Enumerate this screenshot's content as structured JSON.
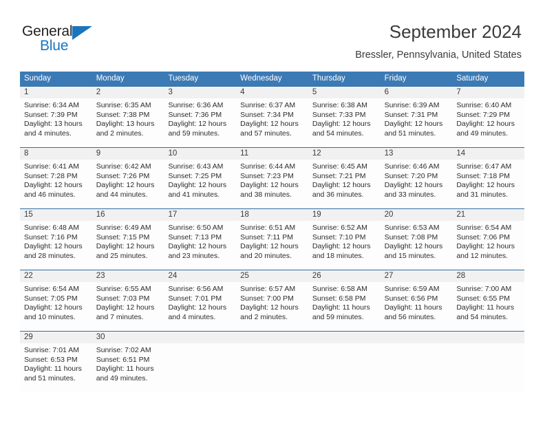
{
  "brand": {
    "name_part1": "General",
    "name_part2": "Blue",
    "accent_color": "#1b75bc"
  },
  "header": {
    "title": "September 2024",
    "subtitle": "Bressler, Pennsylvania, United States"
  },
  "theme": {
    "header_blue": "#3c7ab5",
    "grid_line": "#2e6da4",
    "date_band": "#f1f1f1"
  },
  "weekdays": [
    "Sunday",
    "Monday",
    "Tuesday",
    "Wednesday",
    "Thursday",
    "Friday",
    "Saturday"
  ],
  "weeks": [
    [
      {
        "day": "1",
        "sunrise": "Sunrise: 6:34 AM",
        "sunset": "Sunset: 7:39 PM",
        "daylight1": "Daylight: 13 hours",
        "daylight2": "and 4 minutes."
      },
      {
        "day": "2",
        "sunrise": "Sunrise: 6:35 AM",
        "sunset": "Sunset: 7:38 PM",
        "daylight1": "Daylight: 13 hours",
        "daylight2": "and 2 minutes."
      },
      {
        "day": "3",
        "sunrise": "Sunrise: 6:36 AM",
        "sunset": "Sunset: 7:36 PM",
        "daylight1": "Daylight: 12 hours",
        "daylight2": "and 59 minutes."
      },
      {
        "day": "4",
        "sunrise": "Sunrise: 6:37 AM",
        "sunset": "Sunset: 7:34 PM",
        "daylight1": "Daylight: 12 hours",
        "daylight2": "and 57 minutes."
      },
      {
        "day": "5",
        "sunrise": "Sunrise: 6:38 AM",
        "sunset": "Sunset: 7:33 PM",
        "daylight1": "Daylight: 12 hours",
        "daylight2": "and 54 minutes."
      },
      {
        "day": "6",
        "sunrise": "Sunrise: 6:39 AM",
        "sunset": "Sunset: 7:31 PM",
        "daylight1": "Daylight: 12 hours",
        "daylight2": "and 51 minutes."
      },
      {
        "day": "7",
        "sunrise": "Sunrise: 6:40 AM",
        "sunset": "Sunset: 7:29 PM",
        "daylight1": "Daylight: 12 hours",
        "daylight2": "and 49 minutes."
      }
    ],
    [
      {
        "day": "8",
        "sunrise": "Sunrise: 6:41 AM",
        "sunset": "Sunset: 7:28 PM",
        "daylight1": "Daylight: 12 hours",
        "daylight2": "and 46 minutes."
      },
      {
        "day": "9",
        "sunrise": "Sunrise: 6:42 AM",
        "sunset": "Sunset: 7:26 PM",
        "daylight1": "Daylight: 12 hours",
        "daylight2": "and 44 minutes."
      },
      {
        "day": "10",
        "sunrise": "Sunrise: 6:43 AM",
        "sunset": "Sunset: 7:25 PM",
        "daylight1": "Daylight: 12 hours",
        "daylight2": "and 41 minutes."
      },
      {
        "day": "11",
        "sunrise": "Sunrise: 6:44 AM",
        "sunset": "Sunset: 7:23 PM",
        "daylight1": "Daylight: 12 hours",
        "daylight2": "and 38 minutes."
      },
      {
        "day": "12",
        "sunrise": "Sunrise: 6:45 AM",
        "sunset": "Sunset: 7:21 PM",
        "daylight1": "Daylight: 12 hours",
        "daylight2": "and 36 minutes."
      },
      {
        "day": "13",
        "sunrise": "Sunrise: 6:46 AM",
        "sunset": "Sunset: 7:20 PM",
        "daylight1": "Daylight: 12 hours",
        "daylight2": "and 33 minutes."
      },
      {
        "day": "14",
        "sunrise": "Sunrise: 6:47 AM",
        "sunset": "Sunset: 7:18 PM",
        "daylight1": "Daylight: 12 hours",
        "daylight2": "and 31 minutes."
      }
    ],
    [
      {
        "day": "15",
        "sunrise": "Sunrise: 6:48 AM",
        "sunset": "Sunset: 7:16 PM",
        "daylight1": "Daylight: 12 hours",
        "daylight2": "and 28 minutes."
      },
      {
        "day": "16",
        "sunrise": "Sunrise: 6:49 AM",
        "sunset": "Sunset: 7:15 PM",
        "daylight1": "Daylight: 12 hours",
        "daylight2": "and 25 minutes."
      },
      {
        "day": "17",
        "sunrise": "Sunrise: 6:50 AM",
        "sunset": "Sunset: 7:13 PM",
        "daylight1": "Daylight: 12 hours",
        "daylight2": "and 23 minutes."
      },
      {
        "day": "18",
        "sunrise": "Sunrise: 6:51 AM",
        "sunset": "Sunset: 7:11 PM",
        "daylight1": "Daylight: 12 hours",
        "daylight2": "and 20 minutes."
      },
      {
        "day": "19",
        "sunrise": "Sunrise: 6:52 AM",
        "sunset": "Sunset: 7:10 PM",
        "daylight1": "Daylight: 12 hours",
        "daylight2": "and 18 minutes."
      },
      {
        "day": "20",
        "sunrise": "Sunrise: 6:53 AM",
        "sunset": "Sunset: 7:08 PM",
        "daylight1": "Daylight: 12 hours",
        "daylight2": "and 15 minutes."
      },
      {
        "day": "21",
        "sunrise": "Sunrise: 6:54 AM",
        "sunset": "Sunset: 7:06 PM",
        "daylight1": "Daylight: 12 hours",
        "daylight2": "and 12 minutes."
      }
    ],
    [
      {
        "day": "22",
        "sunrise": "Sunrise: 6:54 AM",
        "sunset": "Sunset: 7:05 PM",
        "daylight1": "Daylight: 12 hours",
        "daylight2": "and 10 minutes."
      },
      {
        "day": "23",
        "sunrise": "Sunrise: 6:55 AM",
        "sunset": "Sunset: 7:03 PM",
        "daylight1": "Daylight: 12 hours",
        "daylight2": "and 7 minutes."
      },
      {
        "day": "24",
        "sunrise": "Sunrise: 6:56 AM",
        "sunset": "Sunset: 7:01 PM",
        "daylight1": "Daylight: 12 hours",
        "daylight2": "and 4 minutes."
      },
      {
        "day": "25",
        "sunrise": "Sunrise: 6:57 AM",
        "sunset": "Sunset: 7:00 PM",
        "daylight1": "Daylight: 12 hours",
        "daylight2": "and 2 minutes."
      },
      {
        "day": "26",
        "sunrise": "Sunrise: 6:58 AM",
        "sunset": "Sunset: 6:58 PM",
        "daylight1": "Daylight: 11 hours",
        "daylight2": "and 59 minutes."
      },
      {
        "day": "27",
        "sunrise": "Sunrise: 6:59 AM",
        "sunset": "Sunset: 6:56 PM",
        "daylight1": "Daylight: 11 hours",
        "daylight2": "and 56 minutes."
      },
      {
        "day": "28",
        "sunrise": "Sunrise: 7:00 AM",
        "sunset": "Sunset: 6:55 PM",
        "daylight1": "Daylight: 11 hours",
        "daylight2": "and 54 minutes."
      }
    ],
    [
      {
        "day": "29",
        "sunrise": "Sunrise: 7:01 AM",
        "sunset": "Sunset: 6:53 PM",
        "daylight1": "Daylight: 11 hours",
        "daylight2": "and 51 minutes."
      },
      {
        "day": "30",
        "sunrise": "Sunrise: 7:02 AM",
        "sunset": "Sunset: 6:51 PM",
        "daylight1": "Daylight: 11 hours",
        "daylight2": "and 49 minutes."
      },
      {
        "day": "",
        "sunrise": "",
        "sunset": "",
        "daylight1": "",
        "daylight2": ""
      },
      {
        "day": "",
        "sunrise": "",
        "sunset": "",
        "daylight1": "",
        "daylight2": ""
      },
      {
        "day": "",
        "sunrise": "",
        "sunset": "",
        "daylight1": "",
        "daylight2": ""
      },
      {
        "day": "",
        "sunrise": "",
        "sunset": "",
        "daylight1": "",
        "daylight2": ""
      },
      {
        "day": "",
        "sunrise": "",
        "sunset": "",
        "daylight1": "",
        "daylight2": ""
      }
    ]
  ]
}
